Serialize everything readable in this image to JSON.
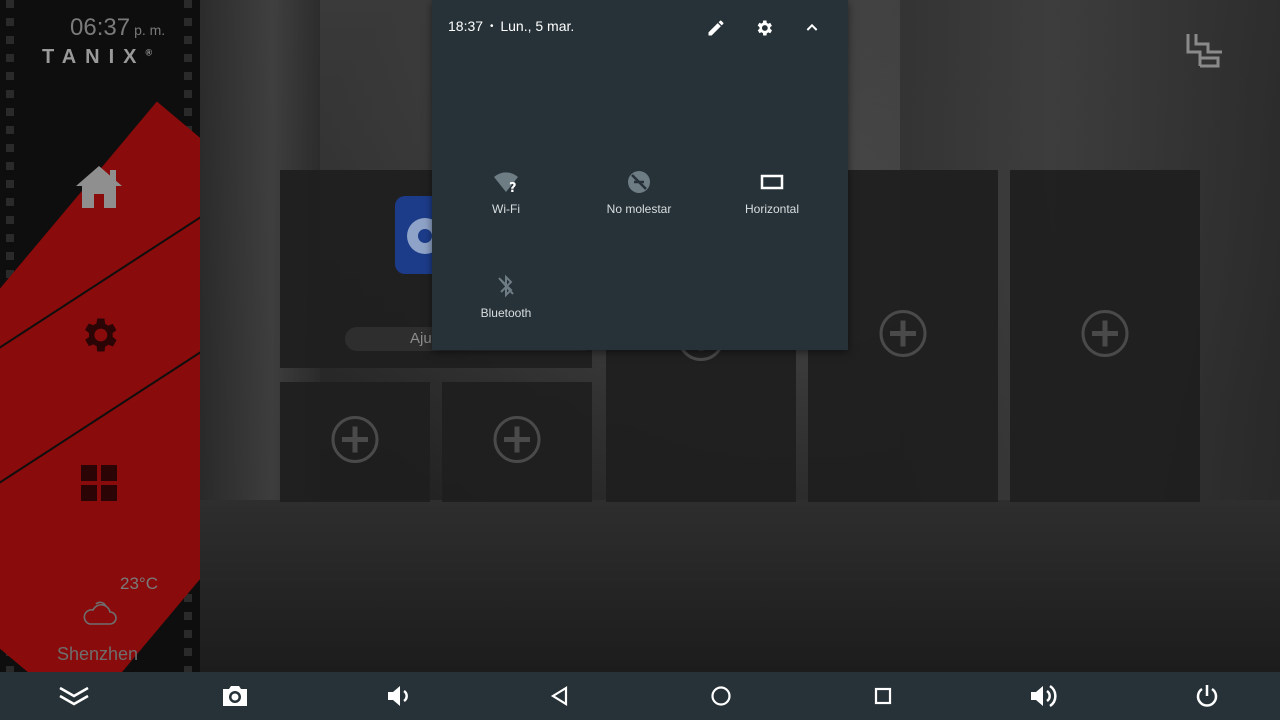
{
  "launcher": {
    "clock": "06:37",
    "clock_ampm": "p. m.",
    "brand": "TANIX",
    "brand_mark": "®",
    "nav": [
      {
        "icon": "home-icon"
      },
      {
        "icon": "gear-icon"
      },
      {
        "icon": "apps-grid-icon"
      }
    ],
    "weather": {
      "temperature": "23°C",
      "icon": "cloud-icon",
      "city": "Shenzhen"
    }
  },
  "tiles": {
    "settings_app_label": "Aju",
    "add_icon": "plus-circle-icon"
  },
  "quick_settings": {
    "time": "18:37",
    "separator": "•",
    "date": "Lun., 5 mar.",
    "header_icons": [
      "pencil-icon",
      "gear-icon",
      "chevron-up-icon"
    ],
    "tiles": [
      {
        "label": "Wi-Fi",
        "icon": "wifi-unknown-icon"
      },
      {
        "label": "No molestar",
        "icon": "do-not-disturb-icon"
      },
      {
        "label": "Horizontal",
        "icon": "landscape-rotation-icon"
      },
      {
        "label": "Bluetooth",
        "icon": "bluetooth-off-icon"
      }
    ]
  },
  "bottom_bar": {
    "buttons": [
      "expand-down-icon",
      "screenshot-camera-icon",
      "volume-down-icon",
      "back-icon",
      "home-circle-icon",
      "recents-square-icon",
      "volume-up-icon",
      "power-icon"
    ]
  },
  "colors": {
    "panel_bg": "#263238",
    "accent_red": "#8a0b0b",
    "icon_fg": "#ffffff"
  }
}
